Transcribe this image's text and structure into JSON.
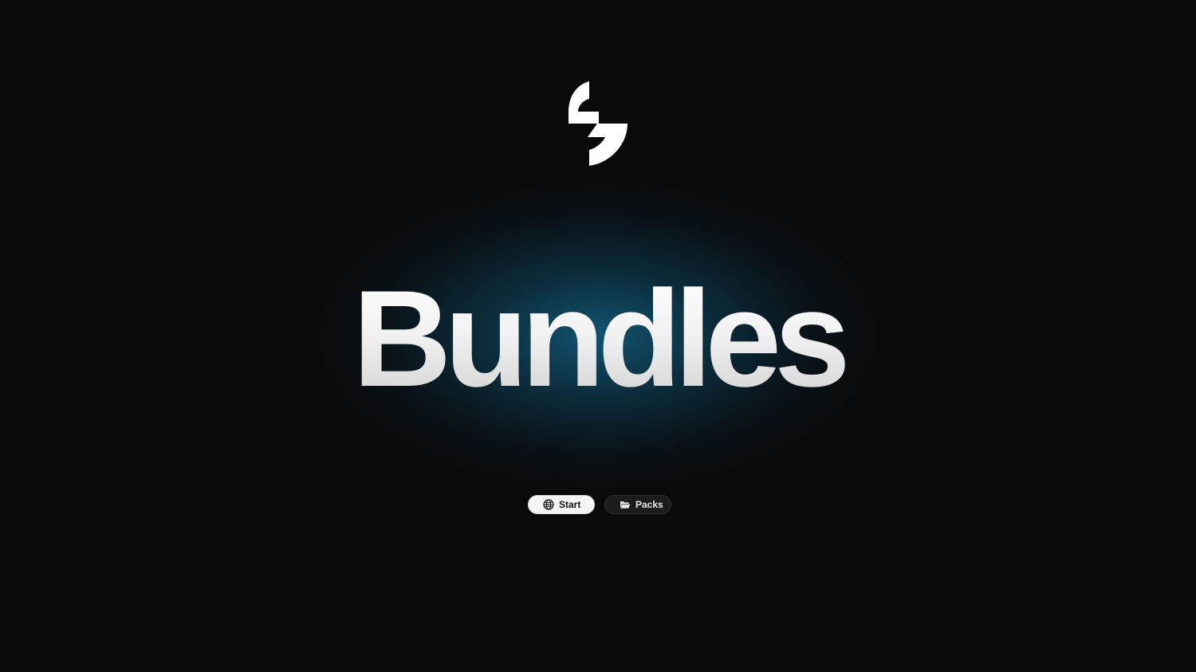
{
  "hero": {
    "title": "Bundles"
  },
  "logo": {
    "icon": "brand-s-logo",
    "color": "#ffffff"
  },
  "nav": {
    "start": {
      "label": "Start",
      "icon": "globe-icon"
    },
    "packs": {
      "label": "Packs",
      "icon": "folder-open-icon"
    }
  },
  "colors": {
    "background": "#0a0a0b",
    "glow": "#125876",
    "title": "#ececec",
    "pill_light": "#f4f4f4",
    "pill_dark": "#1c1c1e"
  }
}
